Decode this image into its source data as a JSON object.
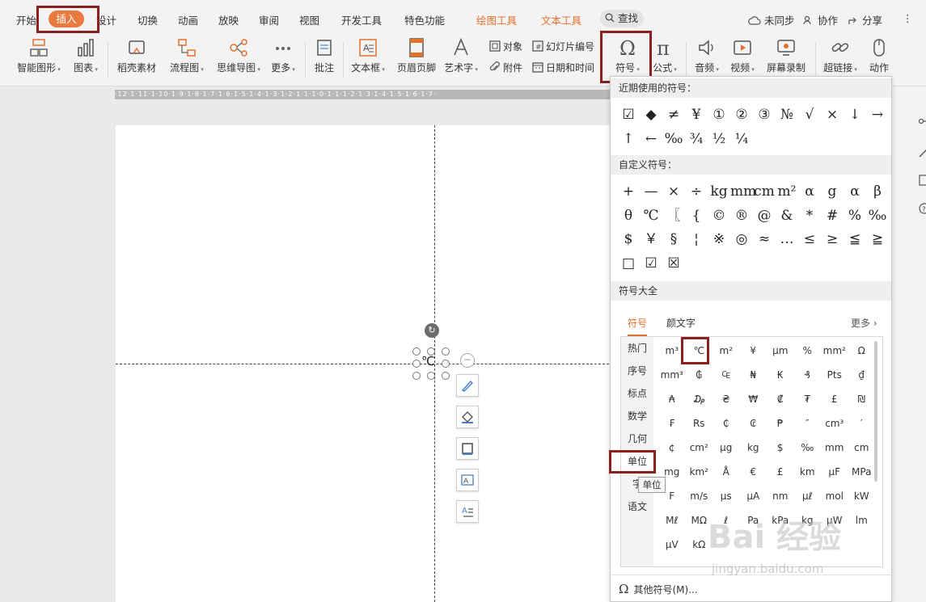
{
  "menu": {
    "tabs": [
      "开始",
      "插入",
      "设计",
      "切换",
      "动画",
      "放映",
      "审阅",
      "视图",
      "开发工具",
      "特色功能"
    ],
    "active_tab": "插入",
    "context_tabs": [
      "绘图工具",
      "文本工具"
    ],
    "search": "查找",
    "unsynced": "未同步",
    "collab": "协作",
    "share": "分享",
    "kebab": "⋮"
  },
  "ribbon": {
    "smart_shape": "智能图形",
    "chart": "图表",
    "shell_material": "稻壳素材",
    "flowchart": "流程图",
    "mindmap": "思维导图",
    "more": "更多",
    "comment": "批注",
    "textbox": "文本框",
    "header_footer": "页眉页脚",
    "wordart": "艺术字",
    "object": "对象",
    "attachment": "附件",
    "slide_number": "幻灯片编号",
    "date_time": "日期和时间",
    "symbol": "符号",
    "formula": "公式",
    "audio": "音频",
    "video": "视频",
    "screen_record": "屏幕录制",
    "hyperlink": "超链接",
    "action": "动作"
  },
  "ruler": {
    "text": "·12·1·11·1·10·1·9·1·8·1·7·1·6·1·5·1·4·1·3·1·2·1·1·1·0·1·1·1·2·1·3·1·4·1·5·1·6·1·7·"
  },
  "slide": {
    "object_text": "℃"
  },
  "symbol_panel": {
    "recent_header": "近期使用的符号：",
    "recent": [
      "☑",
      "◆",
      "≠",
      "¥",
      "①",
      "②",
      "③",
      "№",
      "√",
      "×",
      "↓",
      "→",
      "↑",
      "←",
      "‰",
      "¾",
      "½",
      "¼"
    ],
    "custom_header": "自定义符号：",
    "custom": [
      "+",
      "—",
      "×",
      "÷",
      "kg",
      "mm",
      "cm",
      "m²",
      "α",
      "g",
      "α",
      "β",
      "θ",
      "℃",
      "〖",
      "{",
      "©",
      "®",
      "@",
      "&",
      "*",
      "#",
      "%",
      "‰",
      "$",
      "￥",
      "§",
      "¦",
      "※",
      "◎",
      "≈",
      "…",
      "≤",
      "≥",
      "≦",
      "≧",
      "□",
      "☑",
      "☒"
    ],
    "all_header": "符号大全",
    "subtabs": [
      "符号",
      "颜文字"
    ],
    "more_link": "更多",
    "categories": [
      "热门",
      "序号",
      "标点",
      "数学",
      "几何",
      "单位",
      "字",
      "语文"
    ],
    "selected_category": "单位",
    "units": [
      "m³",
      "℃",
      "m²",
      "¥",
      "μm",
      "%",
      "mm²",
      "Ω",
      "mm³",
      "₲",
      "₠",
      "₦",
      "₭",
      "₰",
      "Pts",
      "₫",
      "₳",
      "₯",
      "₴",
      "₩",
      "₡",
      "₮",
      "£",
      "₪",
      "₣",
      "Rs",
      "₵",
      "₢",
      "₱",
      "″",
      "cm³",
      "′",
      "¢",
      "cm²",
      "μg",
      "kg",
      "$",
      "‰",
      "mm",
      "cm",
      "mg",
      "km²",
      "Å",
      "€",
      "£",
      "km",
      "μF",
      "MPa",
      "F",
      "m/s",
      "μs",
      "μA",
      "nm",
      "μℓ",
      "mol",
      "kW",
      "Mℓ",
      "MΩ",
      "ℓ",
      "Pa",
      "kPa",
      "kg",
      "μW",
      "lm",
      "μV",
      "kΩ",
      "",
      "",
      "",
      "",
      "",
      ""
    ],
    "selected_unit": "℃",
    "tooltip": "单位",
    "footer": "其他符号(M)..."
  },
  "watermark": {
    "brand": "Bai 经验",
    "url": "jingyan.baidu.com"
  }
}
